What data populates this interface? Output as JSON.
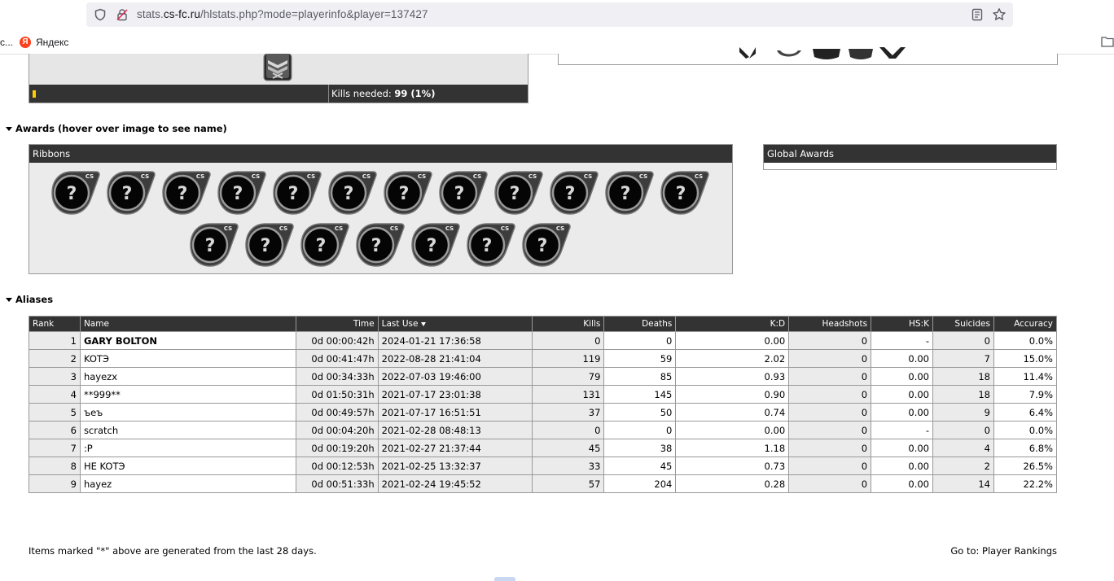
{
  "browser": {
    "url_prefix": "stats.",
    "url_domain": "cs-fc.ru",
    "url_path": "/hlstats.php?mode=playerinfo&player=137427",
    "bookmark_truncated": "c...",
    "bookmark_yandex": "Яндекс",
    "yandex_logo": "Я"
  },
  "rank": {
    "kills_needed_label": "Kills needed:",
    "kills_needed_value": "99 (1%)",
    "progress_fraction": 0.01
  },
  "awards": {
    "heading": "Awards (hover over image to see name)",
    "ribbons_title": "Ribbons",
    "global_title": "Global Awards",
    "ribbon_count": 19,
    "ribbon_badge": "CS",
    "ribbon_glyph": "?"
  },
  "aliases": {
    "heading": "Aliases",
    "columns": [
      "Rank",
      "Name",
      "Time",
      "Last Use",
      "Kills",
      "Deaths",
      "K:D",
      "Headshots",
      "HS:K",
      "Suicides",
      "Accuracy"
    ],
    "rows": [
      [
        "1",
        "GARY BOLTON",
        "0d 00:00:42h",
        "2024-01-21 17:36:58",
        "0",
        "0",
        "0.00",
        "0",
        "-",
        "0",
        "0.0%"
      ],
      [
        "2",
        "KOTЭ",
        "0d 00:41:47h",
        "2022-08-28 21:41:04",
        "119",
        "59",
        "2.02",
        "0",
        "0.00",
        "7",
        "15.0%"
      ],
      [
        "3",
        "hayezx",
        "0d 00:34:33h",
        "2022-07-03 19:46:00",
        "79",
        "85",
        "0.93",
        "0",
        "0.00",
        "18",
        "11.4%"
      ],
      [
        "4",
        "**999**",
        "0d 01:50:31h",
        "2021-07-17 23:01:38",
        "131",
        "145",
        "0.90",
        "0",
        "0.00",
        "18",
        "7.9%"
      ],
      [
        "5",
        "ъеъ",
        "0d 00:49:57h",
        "2021-07-17 16:51:51",
        "37",
        "50",
        "0.74",
        "0",
        "0.00",
        "9",
        "6.4%"
      ],
      [
        "6",
        "scratch",
        "0d 00:04:20h",
        "2021-02-28 08:48:13",
        "0",
        "0",
        "0.00",
        "0",
        "-",
        "0",
        "0.0%"
      ],
      [
        "7",
        ":P",
        "0d 00:19:20h",
        "2021-02-27 21:37:44",
        "45",
        "38",
        "1.18",
        "0",
        "0.00",
        "4",
        "6.8%"
      ],
      [
        "8",
        "HE KOTЭ",
        "0d 00:12:53h",
        "2021-02-25 13:32:37",
        "33",
        "45",
        "0.73",
        "0",
        "0.00",
        "2",
        "26.5%"
      ],
      [
        "9",
        "hayez",
        "0d 00:51:33h",
        "2021-02-24 19:45:52",
        "57",
        "204",
        "0.28",
        "0",
        "0.00",
        "14",
        "22.2%"
      ]
    ]
  },
  "footer": {
    "note": "Items marked \"*\" above are generated from the last 28 days.",
    "goto_label": "Go to:",
    "goto_link": "Player Rankings"
  }
}
